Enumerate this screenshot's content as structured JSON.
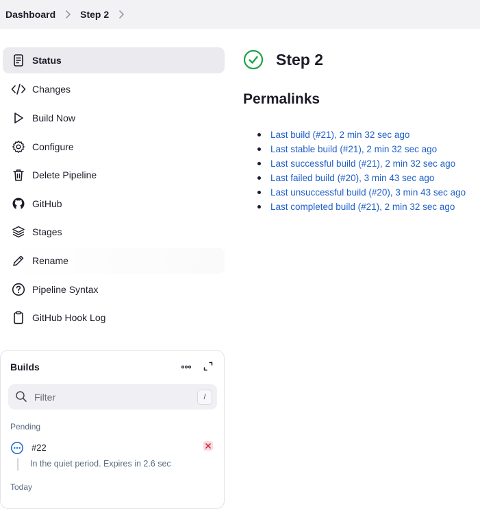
{
  "breadcrumb": {
    "items": [
      "Dashboard",
      "Step 2"
    ]
  },
  "sidebar": {
    "items": [
      {
        "label": "Status",
        "icon": "document-icon"
      },
      {
        "label": "Changes",
        "icon": "code-icon"
      },
      {
        "label": "Build Now",
        "icon": "play-icon"
      },
      {
        "label": "Configure",
        "icon": "gear-icon"
      },
      {
        "label": "Delete Pipeline",
        "icon": "trash-icon"
      },
      {
        "label": "GitHub",
        "icon": "github-icon"
      },
      {
        "label": "Stages",
        "icon": "layers-icon"
      },
      {
        "label": "Rename",
        "icon": "pencil-icon"
      },
      {
        "label": "Pipeline Syntax",
        "icon": "help-circle-icon"
      },
      {
        "label": "GitHub Hook Log",
        "icon": "clipboard-icon"
      }
    ]
  },
  "main": {
    "title": "Step 2",
    "status_icon": "success-check-icon",
    "status_color": "#1ea446",
    "permalinks_heading": "Permalinks",
    "permalinks": [
      "Last build (#21), 2 min 32 sec ago",
      "Last stable build (#21), 2 min 32 sec ago",
      "Last successful build (#21), 2 min 32 sec ago",
      "Last failed build (#20), 3 min 43 sec ago",
      "Last unsuccessful build (#20), 3 min 43 sec ago",
      "Last completed build (#21), 2 min 32 sec ago"
    ]
  },
  "builds": {
    "title": "Builds",
    "filter_placeholder": "Filter",
    "filter_shortcut": "/",
    "pending_label": "Pending",
    "pending_build": {
      "number": "#22",
      "description": "In the quiet period. Expires in 2.6 sec"
    },
    "today_label": "Today"
  },
  "colors": {
    "link": "#1f5fc8",
    "accent_blue": "#1f6fd4",
    "success": "#1ea446",
    "danger": "#d22a3a"
  }
}
